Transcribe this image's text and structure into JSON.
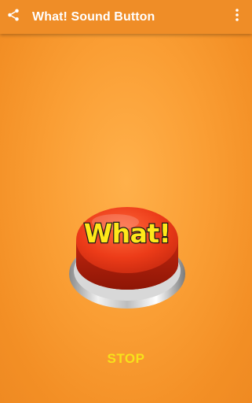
{
  "appbar": {
    "title": "What! Sound Button",
    "share_icon": "share-icon",
    "menu_icon": "more-vert-icon"
  },
  "main": {
    "button_label": "What!",
    "stop_label": "STOP"
  },
  "colors": {
    "appbar": "#ef8d27",
    "background": "#f99c33",
    "button_red": "#e83a1a",
    "label_yellow": "#ffe81a",
    "stop_yellow": "#f7e21a"
  }
}
